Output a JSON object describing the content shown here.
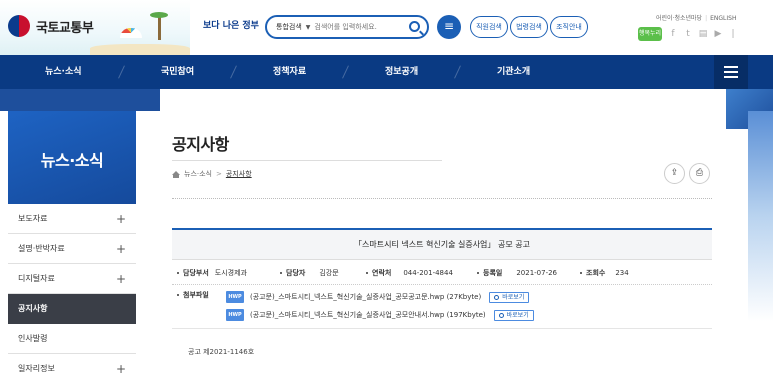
{
  "header": {
    "logo_text": "국토교통부",
    "gov_logo_text": "보다 나은 정부",
    "search": {
      "category": "통합검색",
      "placeholder": "검색어를 입력하세요."
    },
    "pills": [
      "직원검색",
      "법령검색",
      "조직안내"
    ],
    "util_links": [
      "어린이·청소년마당",
      "ENGLISH"
    ],
    "sns_badge": "행복누리"
  },
  "gnb": [
    "뉴스·소식",
    "국민참여",
    "정책자료",
    "정보공개",
    "기관소개"
  ],
  "lnb": {
    "title": "뉴스·소식",
    "items": [
      {
        "label": "보도자료",
        "expandable": true
      },
      {
        "label": "설명·반박자료",
        "expandable": true
      },
      {
        "label": "디지털자료",
        "expandable": true
      },
      {
        "label": "공지사항",
        "expandable": false,
        "active": true
      },
      {
        "label": "인사발령",
        "expandable": false
      },
      {
        "label": "일자리정보",
        "expandable": true
      }
    ]
  },
  "content": {
    "page_title": "공지사항",
    "breadcrumb": [
      "뉴스·소식",
      "공지사항"
    ],
    "board": {
      "title": "「스마트시티 넥스트 혁신기술 실증사업」 공모 공고",
      "meta": [
        {
          "label": "담당부서",
          "value": "도시경제과"
        },
        {
          "label": "담당자",
          "value": "김강문"
        },
        {
          "label": "연락처",
          "value": "044-201-4844"
        },
        {
          "label": "등록일",
          "value": "2021-07-26"
        },
        {
          "label": "조회수",
          "value": "234"
        }
      ],
      "attach_label": "첨부파일",
      "attachments": [
        {
          "type": "HWP",
          "name": "(공고문)_스마트시티_넥스트_혁신기술_실증사업_공모공고문.hwp (27Kbyte)",
          "view_label": "바로보기"
        },
        {
          "type": "HWP",
          "name": "(공고문)_스마트시티_넥스트_혁신기술_실증사업_공모안내서.hwp (197Kbyte)",
          "view_label": "바로보기"
        }
      ],
      "body": "공고 제2021-1146호"
    }
  },
  "colors": {
    "primary": "#0a3a83",
    "accent": "#1b5fb5",
    "active_menu": "#3a3e47"
  }
}
